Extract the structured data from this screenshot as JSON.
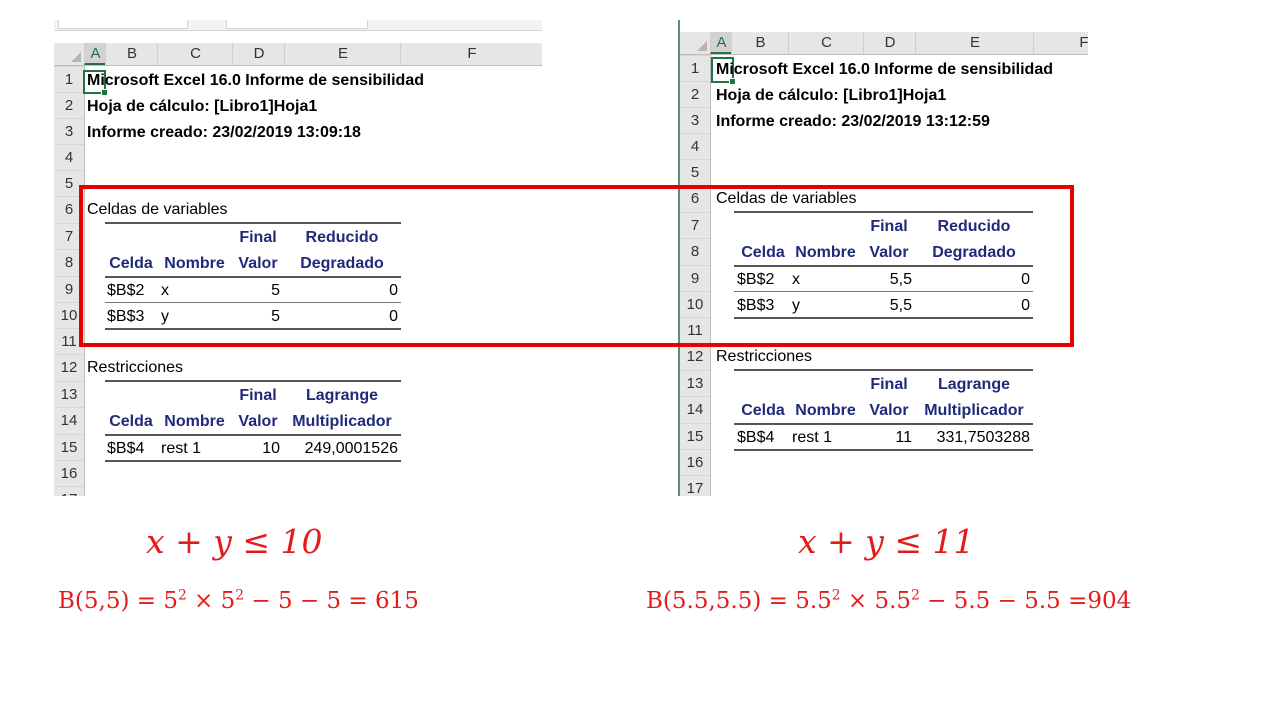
{
  "columns": [
    "A",
    "B",
    "C",
    "D",
    "E",
    "F"
  ],
  "rows": [
    "1",
    "2",
    "3",
    "4",
    "5",
    "6",
    "7",
    "8",
    "9",
    "10",
    "11",
    "12",
    "13",
    "14",
    "15",
    "16",
    "17"
  ],
  "left": {
    "title": "Microsoft Excel 16.0 Informe de sensibilidad",
    "sheet": "Hoja de cálculo: [Libro1]Hoja1",
    "created": "Informe creado: 23/02/2019 13:09:18",
    "vars_heading": "Celdas de variables",
    "vars_headers": {
      "final_top": "Final",
      "reduced_top": "Reducido",
      "cell": "Celda",
      "name": "Nombre",
      "final_bottom": "Valor",
      "reduced_bottom": "Degradado"
    },
    "vars_rows": [
      {
        "cell": "$B$2",
        "name": "x",
        "value": "5",
        "reduced": "0"
      },
      {
        "cell": "$B$3",
        "name": "y",
        "value": "5",
        "reduced": "0"
      }
    ],
    "cons_heading": "Restricciones",
    "cons_headers": {
      "final_top": "Final",
      "lagrange_top": "Lagrange",
      "cell": "Celda",
      "name": "Nombre",
      "final_bottom": "Valor",
      "lagrange_bottom": "Multiplicador"
    },
    "cons_rows": [
      {
        "cell": "$B$4",
        "name": "rest 1",
        "value": "10",
        "lagrange": "249,0001526"
      }
    ]
  },
  "right": {
    "title": "Microsoft Excel 16.0 Informe de sensibilidad",
    "sheet": "Hoja de cálculo: [Libro1]Hoja1",
    "created": "Informe creado: 23/02/2019 13:12:59",
    "vars_heading": "Celdas de variables",
    "vars_headers": {
      "final_top": "Final",
      "reduced_top": "Reducido",
      "cell": "Celda",
      "name": "Nombre",
      "final_bottom": "Valor",
      "reduced_bottom": "Degradado"
    },
    "vars_rows": [
      {
        "cell": "$B$2",
        "name": "x",
        "value": "5,5",
        "reduced": "0"
      },
      {
        "cell": "$B$3",
        "name": "y",
        "value": "5,5",
        "reduced": "0"
      }
    ],
    "cons_heading": "Restricciones",
    "cons_headers": {
      "final_top": "Final",
      "lagrange_top": "Lagrange",
      "cell": "Celda",
      "name": "Nombre",
      "final_bottom": "Valor",
      "lagrange_bottom": "Multiplicador"
    },
    "cons_rows": [
      {
        "cell": "$B$4",
        "name": "rest 1",
        "value": "11",
        "lagrange": "331,7503288"
      }
    ]
  },
  "formulas": {
    "left_constraint": "x + y ≤ 10",
    "left_eval": {
      "lhs": "B(5,5) = 5",
      "mid": " × 5",
      "rhs": " − 5 − 5 = 615",
      "exp": "2"
    },
    "right_constraint": "x + y ≤ 11",
    "right_eval": {
      "lhs": "B(5.5,5.5) = 5.5",
      "mid": " × 5.5",
      "rhs": " − 5.5 − 5.5 =904",
      "exp": "2"
    }
  },
  "colors": {
    "highlight": "#e60000",
    "formula": "#e31b1b",
    "header_text": "#1f2a7a",
    "excel_green": "#217346"
  }
}
